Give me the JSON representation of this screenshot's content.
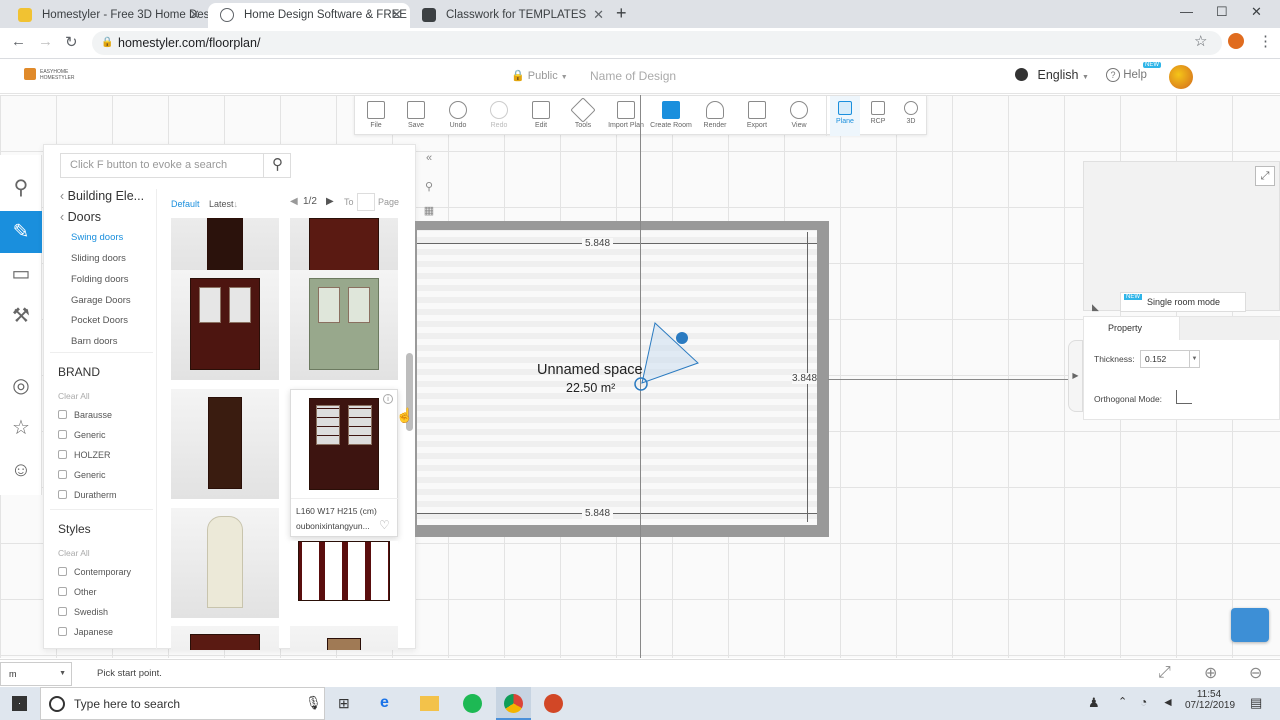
{
  "browser": {
    "tabs": [
      {
        "title": "Homestyler - Free 3D Home Desi...",
        "icon_color": "#f1c232"
      },
      {
        "title": "Home Design Software & FREE Fl...",
        "icon_color": "#5f6368"
      },
      {
        "title": "Classwork for TEMPLATES",
        "icon_color": "#3c4043"
      }
    ],
    "url": "homestyler.com/floorplan/",
    "new_tab": "+",
    "close_glyph": "✕",
    "minimize": "—",
    "maximize": "☐",
    "close": "✕"
  },
  "header": {
    "logo_line1": "EASYHOME",
    "logo_line2": "HOMESTYLER",
    "visibility": "Public",
    "design_name": "Name of Design",
    "language": "English",
    "help": "Help",
    "help_badge": "NEW"
  },
  "toolbar": {
    "file": "File",
    "save": "Save",
    "undo": "Undo",
    "redo": "Redo",
    "edit": "Edit",
    "tools": "Tools",
    "import_plan": "Import Plan",
    "create_room": "Create Room",
    "render": "Render",
    "export": "Export",
    "view": "View",
    "plane": "Plane",
    "rcp": "RCP",
    "view_3d": "3D"
  },
  "catalog": {
    "search_placeholder": "Click F button to evoke a search",
    "breadcrumb_parent": "Building Ele...",
    "breadcrumb_current": "Doors",
    "subcategories": [
      "Swing doors",
      "Sliding doors",
      "Folding doors",
      "Garage Doors",
      "Pocket Doors",
      "Barn doors"
    ],
    "sort_default": "Default",
    "sort_latest": "Latest",
    "page_current": "1/2",
    "page_to": "To",
    "page_label": "Page",
    "brand_title": "BRAND",
    "brand_clear": "Clear All",
    "brands": [
      "Barausse",
      "Generic",
      "HOLZER",
      "Generic",
      "Duratherm"
    ],
    "styles_title": "Styles",
    "styles_clear": "Clear All",
    "styles": [
      "Contemporary",
      "Other",
      "Swedish",
      "Japanese"
    ],
    "hover_dims": "L160 W17 H215 (cm)",
    "hover_name": "oubonixintangyun..."
  },
  "plan": {
    "room_name": "Unnamed space",
    "room_area": "22.50 m²",
    "dim_top": "5.848",
    "dim_bottom": "5.848",
    "dim_right": "3.848"
  },
  "property": {
    "single_room_badge": "NEW",
    "single_room": "Single room mode",
    "tab": "Property",
    "thickness_label": "Thickness:",
    "thickness_value": "0.152",
    "orthogonal_label": "Orthogonal Mode:"
  },
  "status": {
    "unit": "m",
    "hint": "Pick start point."
  },
  "taskbar": {
    "search": "Type here to search",
    "time": "11:54",
    "date": "07/12/2019"
  }
}
